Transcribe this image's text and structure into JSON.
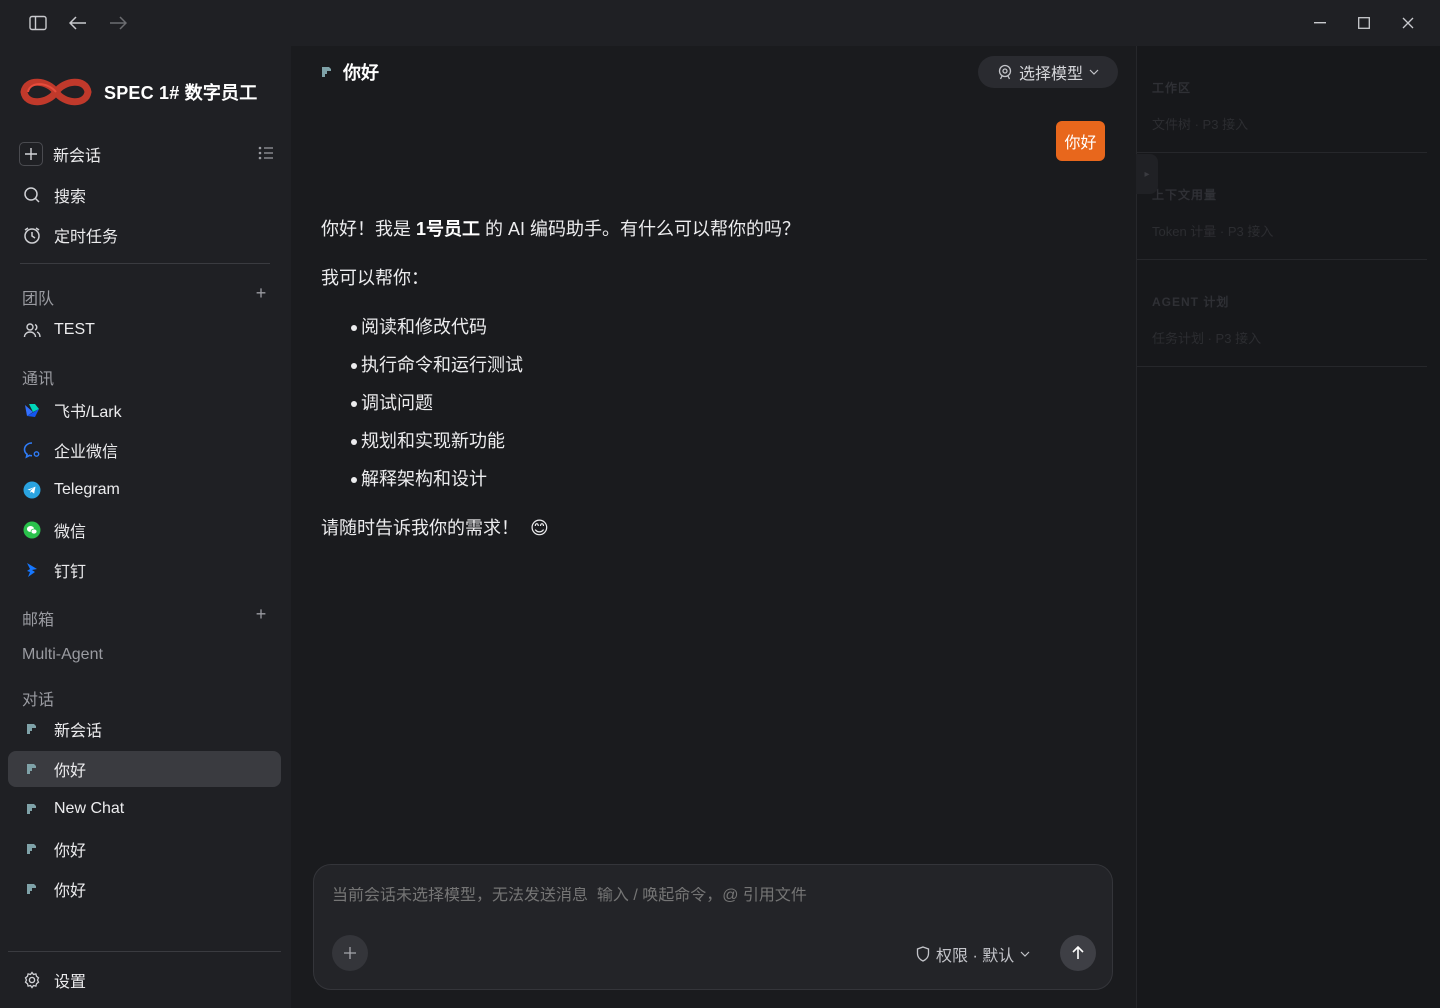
{
  "brand": {
    "name": "SPEC 1# 数字员工"
  },
  "sidebar": {
    "top_items": [
      {
        "label": "新会话",
        "icon": "plus-icon"
      },
      {
        "label": "搜索",
        "icon": "search-icon"
      },
      {
        "label": "定时任务",
        "icon": "clock-icon"
      }
    ],
    "sections": {
      "team": {
        "label": "团队",
        "items": [
          {
            "label": "TEST",
            "icon": "users-icon"
          }
        ]
      },
      "comms": {
        "label": "通讯",
        "items": [
          {
            "label": "飞书/Lark",
            "icon": "lark-icon"
          },
          {
            "label": "企业微信",
            "icon": "wecom-icon"
          },
          {
            "label": "Telegram",
            "icon": "telegram-icon"
          },
          {
            "label": "微信",
            "icon": "wechat-icon"
          },
          {
            "label": "钉钉",
            "icon": "dingtalk-icon"
          }
        ]
      },
      "mail": {
        "label": "邮箱"
      },
      "multi_agent": {
        "label": "Multi-Agent"
      },
      "chats": {
        "label": "对话",
        "items": [
          {
            "label": "新会话"
          },
          {
            "label": "你好",
            "active": true
          },
          {
            "label": "New Chat"
          },
          {
            "label": "你好"
          },
          {
            "label": "你好"
          }
        ]
      }
    },
    "settings_label": "设置"
  },
  "chat": {
    "title": "你好",
    "model_button": "选择模型",
    "user_message": "你好",
    "assistant": {
      "intro_prefix": "你好！我是 ",
      "intro_bold": "1号员工",
      "intro_suffix": " 的 AI 编码助手。有什么可以帮你的吗？",
      "can_help": "我可以帮你：",
      "bullets": [
        "阅读和修改代码",
        "执行命令和运行测试",
        "调试问题",
        "规划和实现新功能",
        "解释架构和设计"
      ],
      "closing": "请随时告诉我你的需求！",
      "closing_emoji": "😊"
    },
    "composer": {
      "placeholder": "当前会话未选择模型，无法发送消息  输入 / 唤起命令，@ 引用文件",
      "permission": "权限 · 默认"
    }
  },
  "right_panel": {
    "sections": [
      {
        "title": "工作区",
        "sub": "文件树 · P3 接入"
      },
      {
        "title": "上下文用量",
        "sub": "Token 计量 · P3 接入"
      },
      {
        "title": "AGENT 计划",
        "sub": "任务计划 · P3 接入"
      }
    ]
  },
  "colors": {
    "accent": "#e8671c",
    "active_row": "#3a3b40"
  }
}
